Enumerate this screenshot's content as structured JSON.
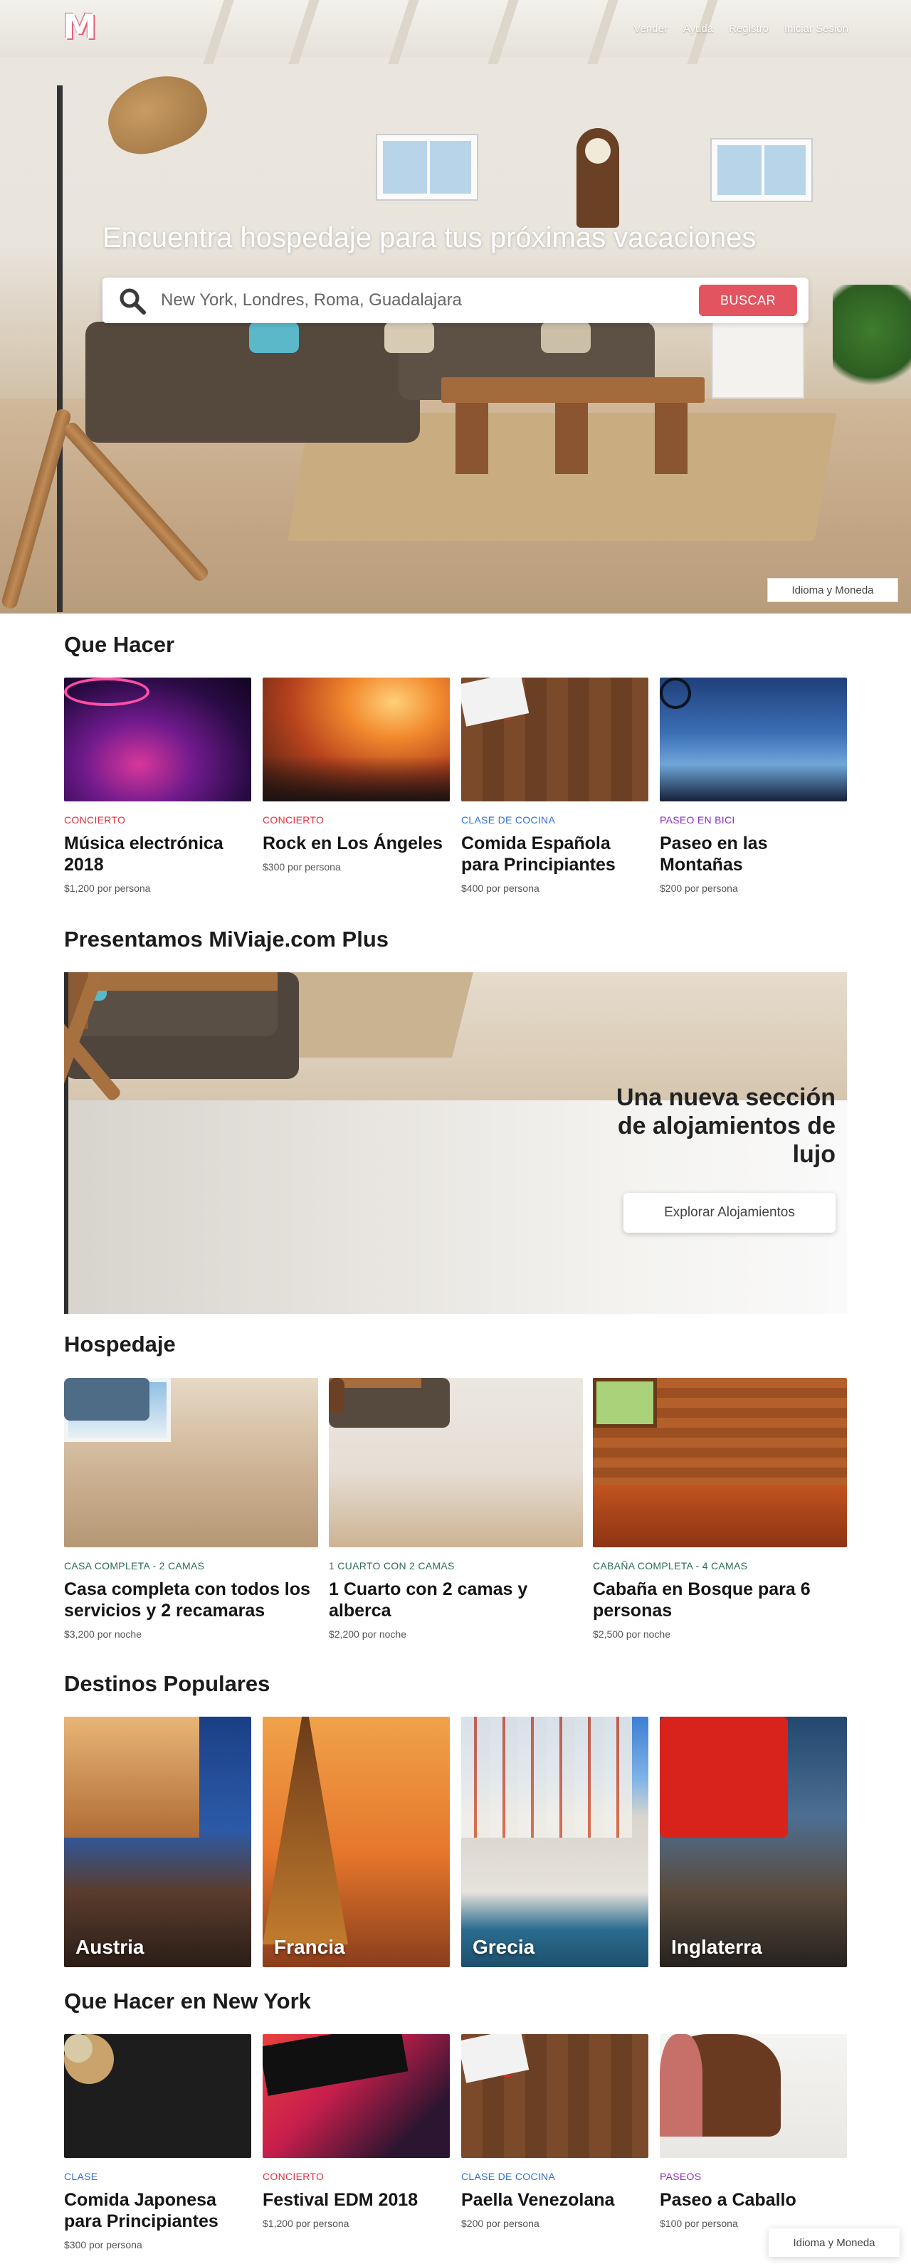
{
  "nav": {
    "logo": "M",
    "links": [
      "Vender",
      "Ayuda",
      "Registro",
      "Iniciar Sesión"
    ]
  },
  "hero": {
    "title": "Encuentra hospedaje para tus próximas vacaciones",
    "search_placeholder": "New York, Londres, Roma, Guadalajara",
    "search_button": "BUSCAR",
    "language_button": "Idioma y Moneda"
  },
  "que_hacer": {
    "title": "Que Hacer",
    "cards": [
      {
        "category": "CONCIERTO",
        "title": "Música electrónica 2018",
        "price": "$1,200 por persona",
        "color": "#e0323f"
      },
      {
        "category": "CONCIERTO",
        "title": "Rock en Los Ángeles",
        "price": "$300 por persona",
        "color": "#e0323f"
      },
      {
        "category": "CLASE DE COCINA",
        "title": "Comida Española para Principiantes",
        "price": "$400 por persona",
        "color": "#2f6fd6"
      },
      {
        "category": "PASEO EN BICI",
        "title": "Paseo en las Montañas",
        "price": "$200 por persona",
        "color": "#8a2fc4"
      }
    ]
  },
  "plus": {
    "title": "Presentamos MiViaje.com Plus",
    "tagline": "Una nueva sección de alojamientos de lujo",
    "button": "Explorar Alojamientos"
  },
  "hospedaje": {
    "title": "Hospedaje",
    "cards": [
      {
        "category": "CASA COMPLETA - 2 CAMAS",
        "title": "Casa completa con todos los servicios y 2 recamaras",
        "price": "$3,200 por noche",
        "color": "#2d6b5b"
      },
      {
        "category": "1 CUARTO CON 2 CAMAS",
        "title": "1 Cuarto con 2 camas y alberca",
        "price": "$2,200 por noche",
        "color": "#2d6b5b"
      },
      {
        "category": "CABAÑA COMPLETA - 4 CAMAS",
        "title": "Cabaña en Bosque para 6 personas",
        "price": "$2,500 por noche",
        "color": "#2d6b5b"
      }
    ]
  },
  "destinos": {
    "title": "Destinos Populares",
    "items": [
      "Austria",
      "Francia",
      "Grecia",
      "Inglaterra"
    ]
  },
  "que_hacer_ny": {
    "title": "Que Hacer en New York",
    "cards": [
      {
        "category": "CLASE",
        "title": "Comida Japonesa para Principiantes",
        "price": "$300 por persona",
        "color": "#2f6fd6"
      },
      {
        "category": "CONCIERTO",
        "title": "Festival EDM 2018",
        "price": "$1,200 por persona",
        "color": "#e0323f"
      },
      {
        "category": "CLASE DE COCINA",
        "title": "Paella Venezolana",
        "price": "$200 por persona",
        "color": "#2f6fd6"
      },
      {
        "category": "PASEOS",
        "title": "Paseo a Caballo",
        "price": "$100 por persona",
        "color": "#8a2fc4"
      }
    ]
  },
  "footer_language_button": "Idioma y Moneda",
  "colors": {
    "accent": "#e2545f",
    "logo_outline": "#e4607a"
  },
  "icons": {
    "search": "search-icon"
  }
}
